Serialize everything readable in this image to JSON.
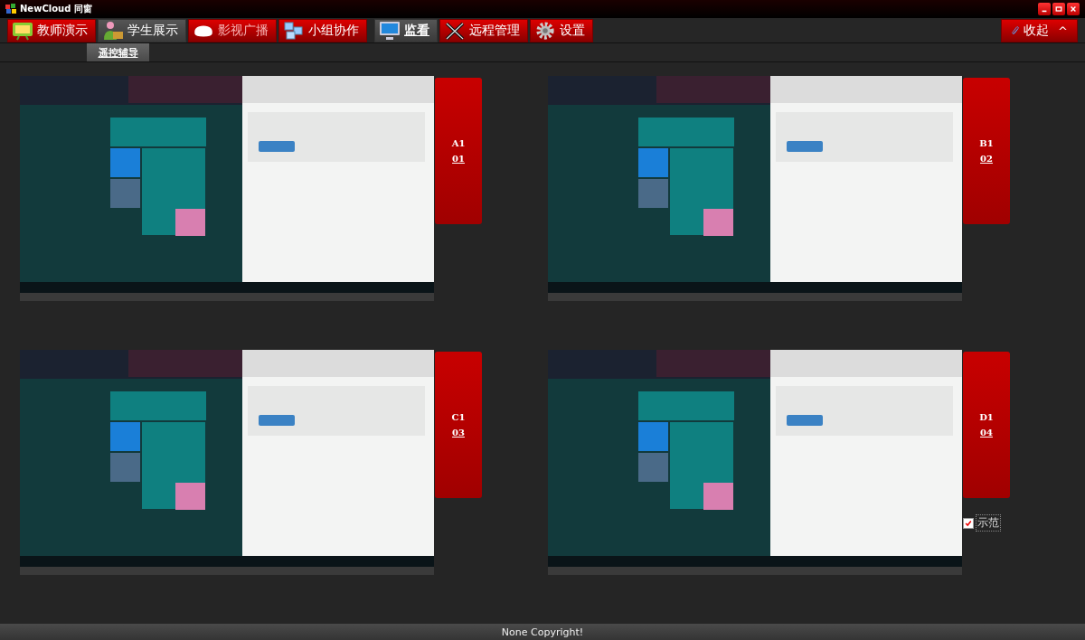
{
  "window": {
    "title": "NewCloud 同窗"
  },
  "toolbar": {
    "tabs": [
      {
        "label": "教师演示",
        "selected": false,
        "highlighted": false,
        "disabled": false
      },
      {
        "label": "学生展示",
        "selected": false,
        "highlighted": true,
        "disabled": false
      },
      {
        "label": "影视广播",
        "selected": false,
        "highlighted": false,
        "disabled": true
      },
      {
        "label": "小组协作",
        "selected": false,
        "highlighted": false,
        "disabled": false
      },
      {
        "label": "监看",
        "selected": true,
        "highlighted": false,
        "disabled": false
      },
      {
        "label": "远程管理",
        "selected": false,
        "highlighted": false,
        "disabled": false
      },
      {
        "label": "设置",
        "selected": false,
        "highlighted": false,
        "disabled": false
      }
    ],
    "collapse_button": {
      "label": "收起",
      "caret": "^"
    }
  },
  "subtabs": [
    {
      "label": "遥控辅导",
      "selected": true
    }
  ],
  "monitors": [
    {
      "label": "A1",
      "number": "01"
    },
    {
      "label": "B1",
      "number": "02"
    },
    {
      "label": "C1",
      "number": "03"
    },
    {
      "label": "D1",
      "number": "04",
      "demo": {
        "label": "示范",
        "checked": true
      }
    }
  ],
  "status_bar": {
    "text": "None Copyright!"
  }
}
